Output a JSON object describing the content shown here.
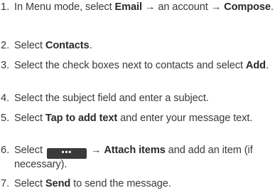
{
  "steps": [
    {
      "number": "1.",
      "parts": [
        {
          "t": "In Menu mode, select "
        },
        {
          "t": "Email",
          "b": true
        },
        {
          "t": " → an account → "
        },
        {
          "t": "Compose",
          "b": true
        },
        {
          "t": "."
        }
      ]
    },
    {
      "number": "2.",
      "parts": [
        {
          "t": "Select "
        },
        {
          "t": "Contacts",
          "b": true
        },
        {
          "t": "."
        }
      ]
    },
    {
      "number": "3.",
      "parts": [
        {
          "t": "Select the check boxes next to contacts and select "
        },
        {
          "t": "Add",
          "b": true
        },
        {
          "t": "."
        }
      ]
    },
    {
      "number": "4.",
      "parts": [
        {
          "t": "Select the subject field and enter a subject."
        }
      ]
    },
    {
      "number": "5.",
      "parts": [
        {
          "t": "Select "
        },
        {
          "t": "Tap to add text",
          "b": true
        },
        {
          "t": " and enter your message text."
        }
      ]
    },
    {
      "number": "6.",
      "parts": [
        {
          "t": "Select "
        },
        {
          "icon": "more-options-icon",
          "glyph": "•••"
        },
        {
          "t": " → "
        },
        {
          "t": "Attach items",
          "b": true
        },
        {
          "t": " and add an item (if necessary)."
        }
      ]
    },
    {
      "number": "7.",
      "parts": [
        {
          "t": "Select "
        },
        {
          "t": "Send",
          "b": true
        },
        {
          "t": " to send the message."
        }
      ]
    }
  ]
}
